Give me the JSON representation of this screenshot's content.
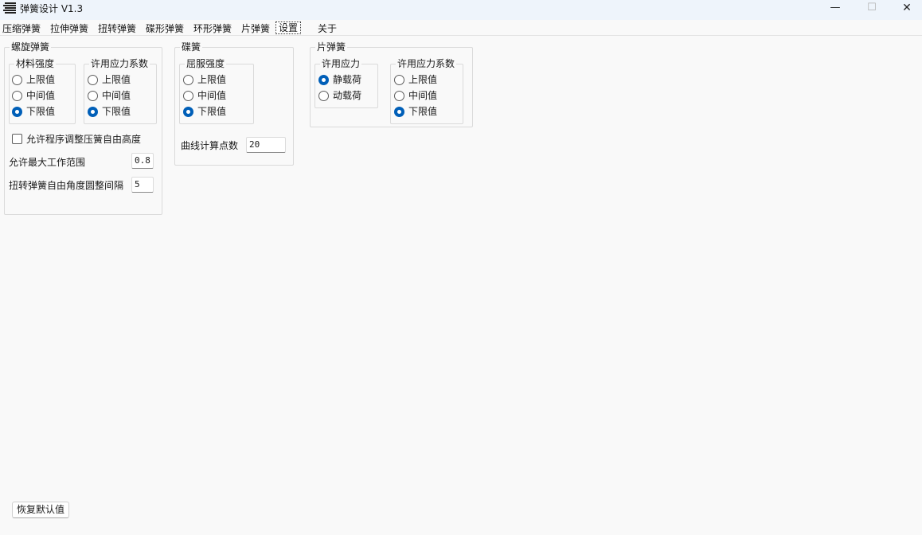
{
  "window": {
    "title": "弹簧设计  V1.3",
    "minimize_glyph": "—",
    "maximize_glyph": "☐",
    "close_glyph": "✕",
    "icon": "spring-app-icon"
  },
  "tabs": [
    {
      "label": "压缩弹簧",
      "active": false
    },
    {
      "label": "拉伸弹簧",
      "active": false
    },
    {
      "label": "扭转弹簧",
      "active": false
    },
    {
      "label": "碟形弹簧",
      "active": false
    },
    {
      "label": "环形弹簧",
      "active": false
    },
    {
      "label": "片弹簧",
      "active": false
    },
    {
      "label": "设置",
      "active": true
    },
    {
      "label": "关于",
      "active": false
    }
  ],
  "helical": {
    "title": "螺旋弹簧",
    "material_strength": {
      "title": "材料强度",
      "options": [
        "上限值",
        "中间值",
        "下限值"
      ],
      "selected": "下限值"
    },
    "allowable_stress_factor": {
      "title": "许用应力系数",
      "options": [
        "上限值",
        "中间值",
        "下限值"
      ],
      "selected": "下限值"
    },
    "allow_adjust_free_height": {
      "label": "允许程序调整压簧自由高度",
      "checked": false
    },
    "max_working_range": {
      "label": "允许最大工作范围",
      "value": "0.8"
    },
    "torsion_angle_interval": {
      "label": "扭转弹簧自由角度圆整间隔",
      "value": "5"
    }
  },
  "disc": {
    "title": "碟簧",
    "yield_strength": {
      "title": "屈服强度",
      "options": [
        "上限值",
        "中间值",
        "下限值"
      ],
      "selected": "下限值"
    },
    "curve_points": {
      "label": "曲线计算点数",
      "value": "20"
    }
  },
  "leaf": {
    "title": "片弹簧",
    "allowable_stress": {
      "title": "许用应力",
      "options": [
        "静载荷",
        "动载荷"
      ],
      "selected": "静载荷"
    },
    "allowable_stress_factor": {
      "title": "许用应力系数",
      "options": [
        "上限值",
        "中间值",
        "下限值"
      ],
      "selected": "下限值"
    }
  },
  "footer": {
    "restore_defaults": "恢复默认值"
  },
  "colors": {
    "accent": "#005fb8",
    "window_bg": "#f9f9f9",
    "titlebar_bg": "#eef4fb"
  }
}
